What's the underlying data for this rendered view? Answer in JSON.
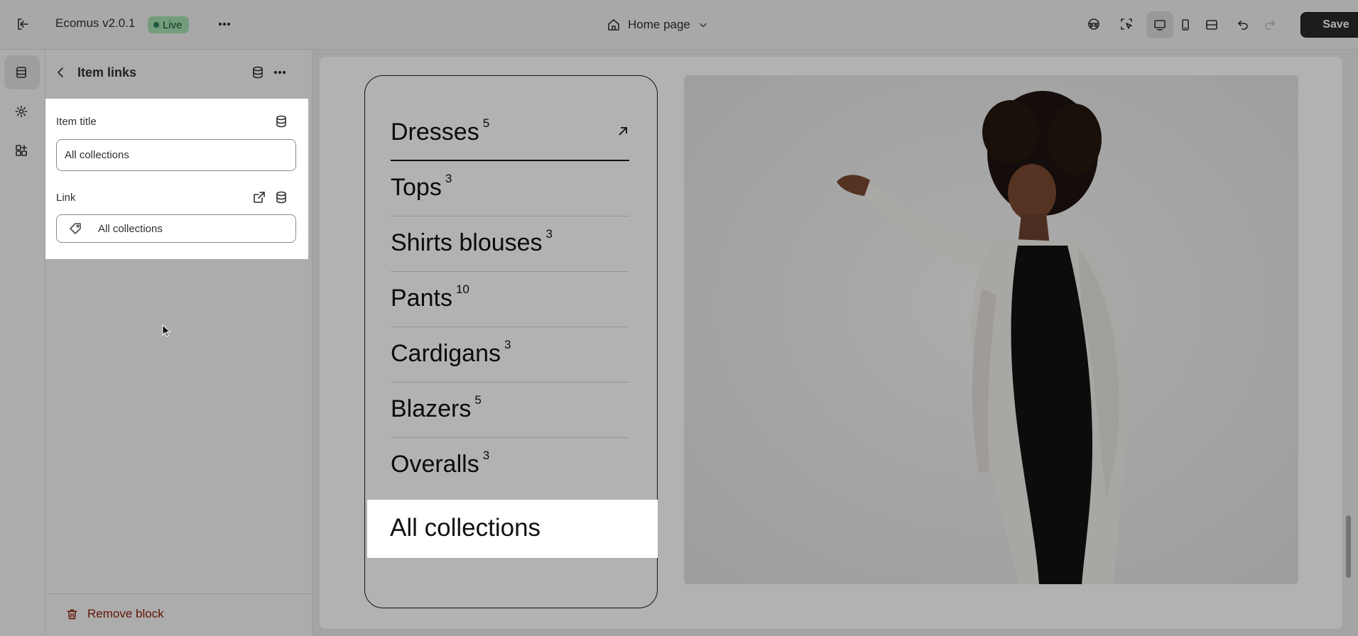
{
  "header": {
    "app_name": "Ecomus v2.0.1",
    "status_badge": "Live",
    "page_selector": "Home page",
    "save_label": "Save"
  },
  "panel": {
    "title": "Item links",
    "item_title_label": "Item title",
    "item_title_value": "All collections",
    "link_label": "Link",
    "link_value": "All collections",
    "remove_label": "Remove block"
  },
  "preview": {
    "menu_items": [
      {
        "name": "Dresses",
        "count": "5"
      },
      {
        "name": "Tops",
        "count": "3"
      },
      {
        "name": "Shirts blouses",
        "count": "3"
      },
      {
        "name": "Pants",
        "count": "10"
      },
      {
        "name": "Cardigans",
        "count": "3"
      },
      {
        "name": "Blazers",
        "count": "5"
      },
      {
        "name": "Overalls",
        "count": "3"
      }
    ],
    "highlighted_item": "All collections"
  }
}
